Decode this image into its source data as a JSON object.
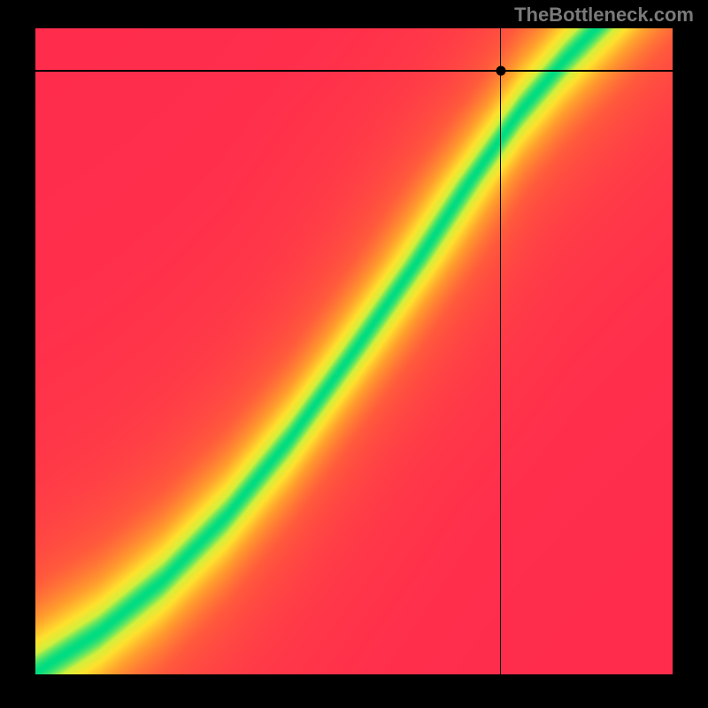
{
  "watermark": "TheBottleneck.com",
  "chart_data": {
    "type": "heatmap",
    "title": "",
    "xlabel": "",
    "ylabel": "",
    "xlim": [
      0,
      1
    ],
    "ylim": [
      0,
      1
    ],
    "crosshair": {
      "x": 0.73,
      "y": 0.934
    },
    "marker": {
      "x": 0.73,
      "y": 0.934
    },
    "optimal_curve": [
      {
        "x": 0.02,
        "y": 0.015
      },
      {
        "x": 0.1,
        "y": 0.065
      },
      {
        "x": 0.2,
        "y": 0.145
      },
      {
        "x": 0.3,
        "y": 0.245
      },
      {
        "x": 0.4,
        "y": 0.365
      },
      {
        "x": 0.5,
        "y": 0.5
      },
      {
        "x": 0.6,
        "y": 0.64
      },
      {
        "x": 0.68,
        "y": 0.76
      },
      {
        "x": 0.76,
        "y": 0.87
      },
      {
        "x": 0.83,
        "y": 0.95
      },
      {
        "x": 0.88,
        "y": 1.0
      }
    ],
    "band_width_x": 0.065,
    "colorscale_note": "red (far from optimal) → orange → yellow → green (on optimal curve)"
  }
}
